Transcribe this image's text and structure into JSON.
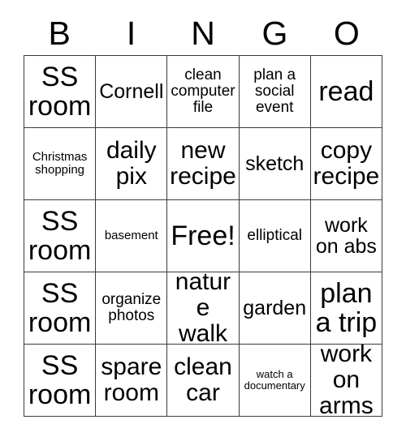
{
  "card": {
    "title": "BINGO Card",
    "header_letters": [
      "B",
      "I",
      "N",
      "G",
      "O"
    ],
    "border_color": "#3a3a3a",
    "text_color": "#000000",
    "background_color": "#ffffff",
    "rows": 5,
    "columns": 5,
    "free_space_label": "Free!",
    "cells": [
      [
        {
          "text": "SS room",
          "size": "xxl"
        },
        {
          "text": "Cornell",
          "size": "l"
        },
        {
          "text": "clean computer file",
          "size": "m"
        },
        {
          "text": "plan a social event",
          "size": "m"
        },
        {
          "text": "read",
          "size": "xxl"
        }
      ],
      [
        {
          "text": "Christmas shopping",
          "size": "s"
        },
        {
          "text": "daily pix",
          "size": "xl"
        },
        {
          "text": "new recipe",
          "size": "xl"
        },
        {
          "text": "sketch",
          "size": "l"
        },
        {
          "text": "copy recipe",
          "size": "xl"
        }
      ],
      [
        {
          "text": "SS room",
          "size": "xxl"
        },
        {
          "text": "basement",
          "size": "s"
        },
        {
          "text": "Free!",
          "size": "xxl"
        },
        {
          "text": "elliptical",
          "size": "m"
        },
        {
          "text": "work on abs",
          "size": "l"
        }
      ],
      [
        {
          "text": "SS room",
          "size": "xxl"
        },
        {
          "text": "organize photos",
          "size": "m"
        },
        {
          "text": "nature walk",
          "size": "xl"
        },
        {
          "text": "garden",
          "size": "l"
        },
        {
          "text": "plan a trip",
          "size": "xxl"
        }
      ],
      [
        {
          "text": "SS room",
          "size": "xxl"
        },
        {
          "text": "spare room",
          "size": "xl"
        },
        {
          "text": "clean car",
          "size": "xl"
        },
        {
          "text": "watch a documentary",
          "size": "xs"
        },
        {
          "text": "work on arms",
          "size": "xl"
        }
      ]
    ]
  }
}
